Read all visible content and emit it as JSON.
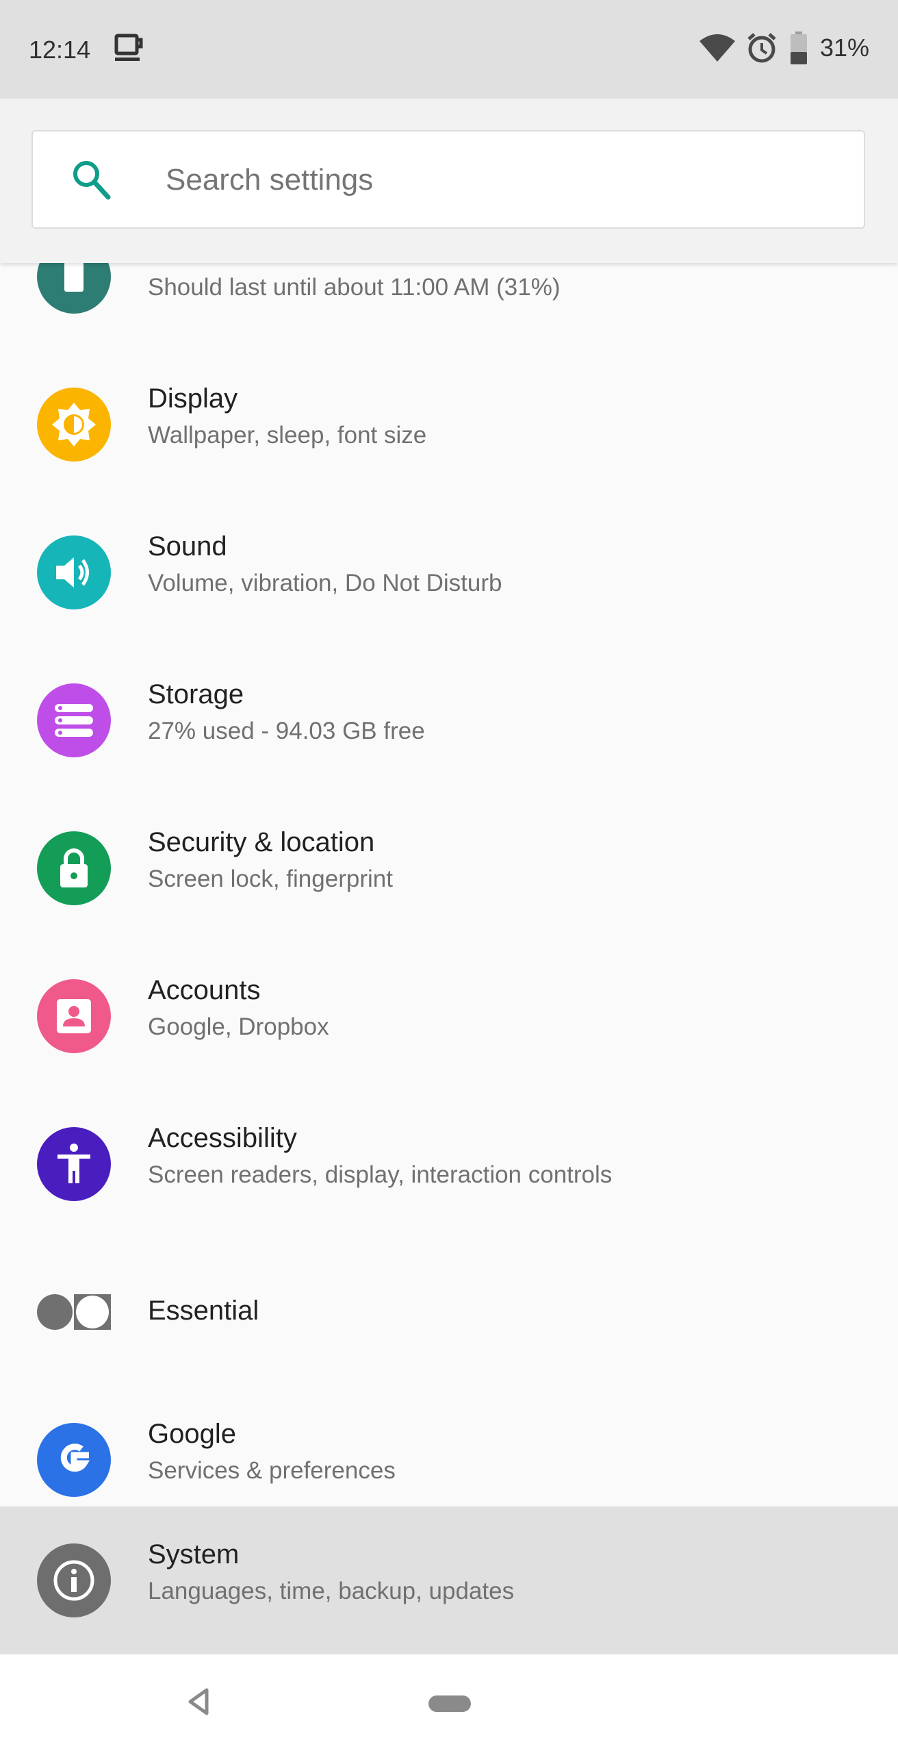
{
  "status_bar": {
    "time": "12:14",
    "battery_percent": "31%",
    "icons": [
      "coffee-cup-icon",
      "wifi-icon",
      "alarm-icon",
      "battery-icon"
    ]
  },
  "search": {
    "placeholder": "Search settings",
    "value": ""
  },
  "settings": {
    "partial_item": {
      "subtitle": "Should last until about 11:00 AM (31%)",
      "icon": "battery-icon",
      "color": "#2e7d74"
    },
    "items": [
      {
        "title": "Display",
        "subtitle": "Wallpaper, sleep, font size",
        "icon": "brightness-icon",
        "color": "#fbb400"
      },
      {
        "title": "Sound",
        "subtitle": "Volume, vibration, Do Not Disturb",
        "icon": "volume-icon",
        "color": "#16b5b8"
      },
      {
        "title": "Storage",
        "subtitle": "27% used - 94.03 GB free",
        "icon": "storage-icon",
        "color": "#bf4ee8"
      },
      {
        "title": "Security & location",
        "subtitle": "Screen lock, fingerprint",
        "icon": "lock-icon",
        "color": "#139d57"
      },
      {
        "title": "Accounts",
        "subtitle": "Google, Dropbox",
        "icon": "account-icon",
        "color": "#ef5a8a"
      },
      {
        "title": "Accessibility",
        "subtitle": "Screen readers, display, interaction controls",
        "icon": "accessibility-icon",
        "color": "#4a1dbf"
      },
      {
        "title": "Essential",
        "subtitle": "",
        "icon": "essential-icon",
        "color": "#707070"
      },
      {
        "title": "Google",
        "subtitle": "Services & preferences",
        "icon": "google-icon",
        "color": "#2a72e6"
      },
      {
        "title": "System",
        "subtitle": "Languages, time, backup, updates",
        "icon": "info-icon",
        "color": "#6e6e6e",
        "highlighted": true
      }
    ]
  },
  "nav_bar": {
    "icons": [
      "back-icon",
      "home-pill"
    ]
  }
}
